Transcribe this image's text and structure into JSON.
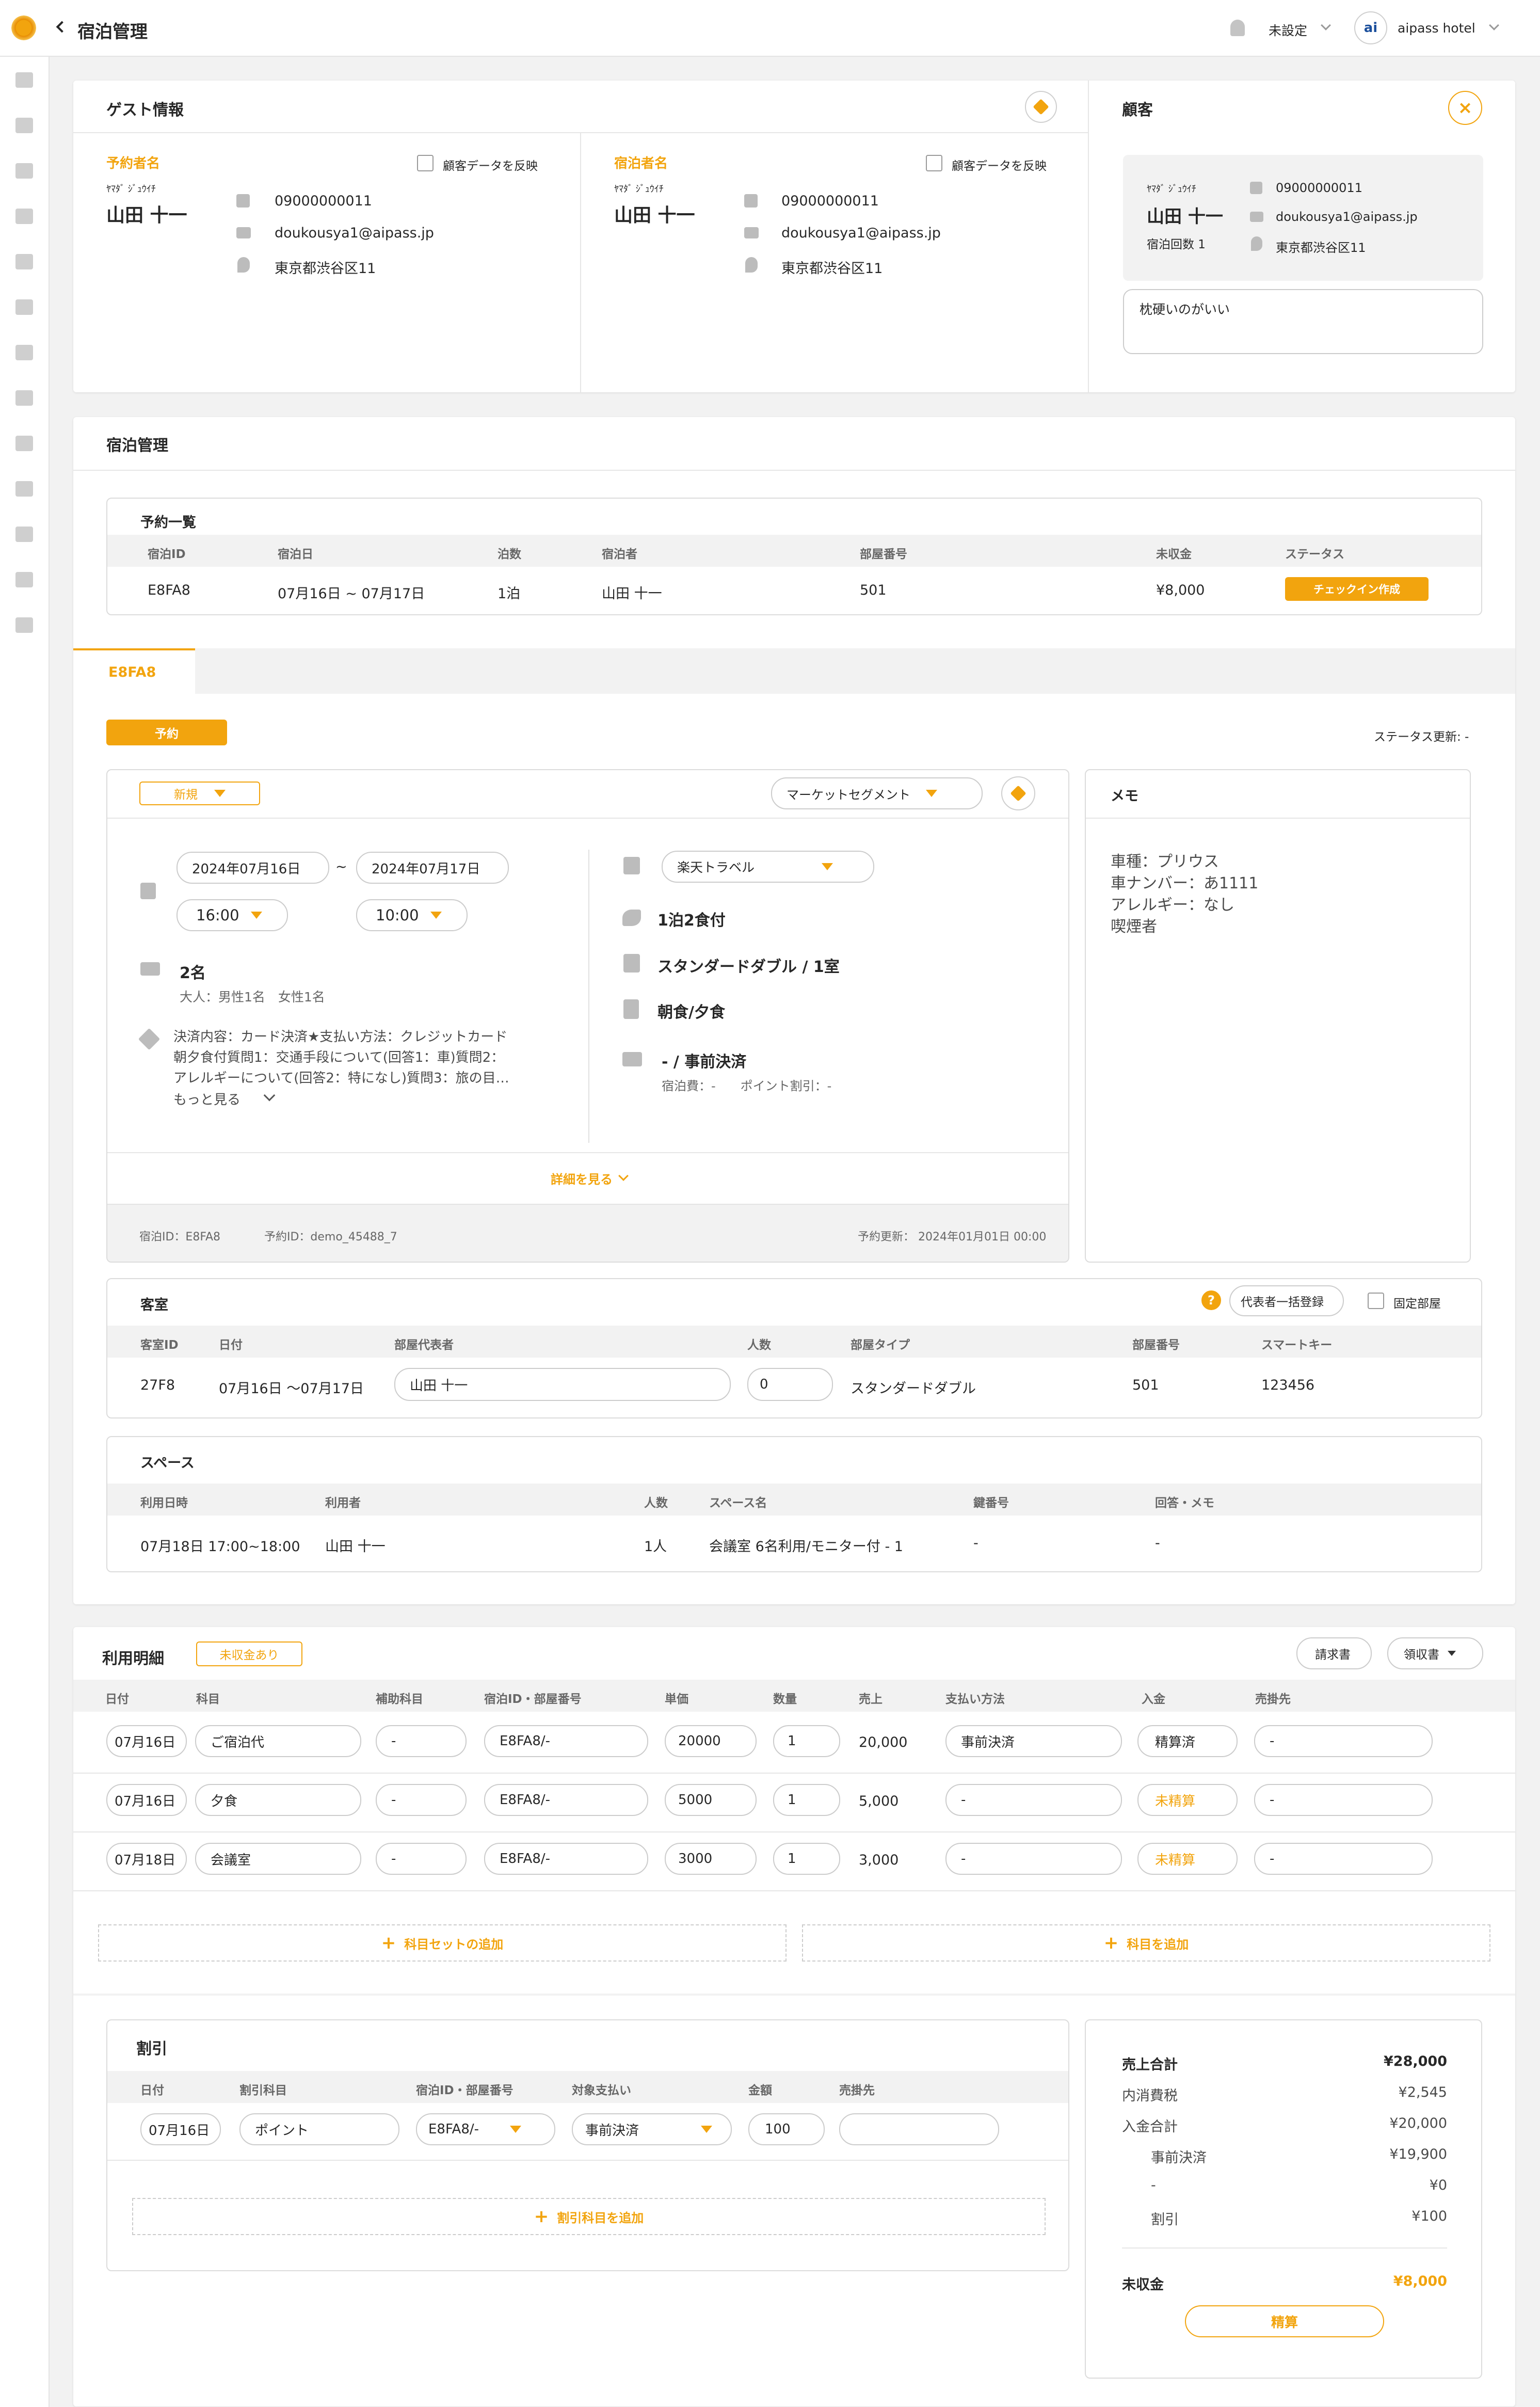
{
  "header": {
    "title": "宿泊管理",
    "notify_status": "未設定",
    "hotel_name": "aipass hotel",
    "logo_text": "ai"
  },
  "sidebar": {
    "icons": [
      "dashboard-icon",
      "bed-icon",
      "id-card-icon",
      "building-icon",
      "calculator-icon",
      "megaphone-icon",
      "service-icon",
      "cleaning-icon",
      "list-icon",
      "mail-icon",
      "chart-icon",
      "news-icon",
      "clock-icon"
    ]
  },
  "guest_info": {
    "title": "ゲスト情報",
    "booker": {
      "label": "予約者名",
      "reflect": "顧客データを反映",
      "kana": "ﾔﾏﾀﾞ ｼﾞｭｳｲﾁ",
      "name": "山田 十一",
      "phone": "09000000011",
      "email": "doukousya1@aipass.jp",
      "address": "東京都渋谷区11"
    },
    "guest": {
      "label": "宿泊者名",
      "reflect": "顧客データを反映",
      "kana": "ﾔﾏﾀﾞ ｼﾞｭｳｲﾁ",
      "name": "山田 十一",
      "phone": "09000000011",
      "email": "doukousya1@aipass.jp",
      "address": "東京都渋谷区11"
    }
  },
  "customer": {
    "title": "顧客",
    "kana": "ﾔﾏﾀﾞ ｼﾞｭｳｲﾁ",
    "name": "山田 十一",
    "stays": "宿泊回数 1",
    "phone": "09000000011",
    "email": "doukousya1@aipass.jp",
    "address": "東京都渋谷区11",
    "note": "枕硬いのがいい"
  },
  "stay": {
    "title": "宿泊管理",
    "reservations": {
      "title": "予約一覧",
      "headers": [
        "宿泊ID",
        "宿泊日",
        "泊数",
        "宿泊者",
        "部屋番号",
        "未収金",
        "ステータス"
      ],
      "row": {
        "id": "E8FA8",
        "date": "07月16日 ~ 07月17日",
        "nights": "1泊",
        "guest": "山田 十一",
        "room": "501",
        "unpaid": "¥8,000",
        "action": "チェックイン作成"
      }
    },
    "tab": "E8FA8",
    "status_badge": "予約",
    "status_updated": "ステータス更新: -",
    "detail": {
      "new_select": "新規",
      "segment_select": "マーケットセグメント",
      "checkin_date": "2024年07月16日",
      "tilde": "~",
      "checkout_date": "2024年07月17日",
      "checkin_time": "16:00",
      "checkout_time": "10:00",
      "people": "2名",
      "people_detail": "大人：男性1名　女性1名",
      "note_lines": [
        "決済内容：カード決済★支払い方法：クレジットカード",
        "朝夕食付質問1：交通手段について(回答1：車)質問2：",
        "アレルギーについて(回答2：特になし)質問3：旅の目…"
      ],
      "more": "もっと見る",
      "channel": "楽天トラベル",
      "plan": "1泊2食付",
      "room_type": "スタンダードダブル / 1室",
      "meal": "朝食/夕食",
      "payment": "- / 事前決済",
      "fees": "宿泊費：-　　ポイント割引：-",
      "detail_link": "詳細を見る",
      "stay_id": "宿泊ID：E8FA8",
      "booking_id": "予約ID：demo_45488_7",
      "updated": "予約更新： 2024年01月01日 00:00"
    },
    "memo": {
      "title": "メモ",
      "lines": [
        "車種：プリウス",
        "車ナンバー：あ1111",
        "アレルギー：なし",
        "喫煙者"
      ]
    },
    "rooms": {
      "title": "客室",
      "bulk": "代表者一括登録",
      "fixed": "固定部屋",
      "help": "?",
      "headers": [
        "客室ID",
        "日付",
        "部屋代表者",
        "人数",
        "部屋タイプ",
        "部屋番号",
        "スマートキー"
      ],
      "row": {
        "id": "27F8",
        "date": "07月16日 〜07月17日",
        "rep": "山田 十一",
        "count": "0",
        "type": "スタンダードダブル",
        "number": "501",
        "key": "123456"
      }
    },
    "space": {
      "title": "スペース",
      "headers": [
        "利用日時",
        "利用者",
        "人数",
        "スペース名",
        "鍵番号",
        "回答・メモ"
      ],
      "row": {
        "datetime": "07月18日 17:00~18:00",
        "user": "山田 十一",
        "count": "1人",
        "name": "会議室 6名利用/モニター付 - 1",
        "key": "-",
        "memo": "-"
      }
    }
  },
  "usage": {
    "title": "利用明細",
    "badge": "未収金あり",
    "invoice": "請求書",
    "receipt": "領収書",
    "headers": [
      "日付",
      "科目",
      "補助科目",
      "宿泊ID・部屋番号",
      "単価",
      "数量",
      "売上",
      "支払い方法",
      "入金",
      "売掛先"
    ],
    "rows": [
      {
        "date": "07月16日",
        "item": "ご宿泊代",
        "sub": "-",
        "id": "E8FA8/-",
        "price": "20000",
        "qty": "1",
        "sales": "20,000",
        "method": "事前決済",
        "paid": "精算済",
        "ar": "-"
      },
      {
        "date": "07月16日",
        "item": "夕食",
        "sub": "-",
        "id": "E8FA8/-",
        "price": "5000",
        "qty": "1",
        "sales": "5,000",
        "method": "-",
        "paid": "未精算",
        "ar": "-"
      },
      {
        "date": "07月18日",
        "item": "会議室",
        "sub": "-",
        "id": "E8FA8/-",
        "price": "3000",
        "qty": "1",
        "sales": "3,000",
        "method": "-",
        "paid": "未精算",
        "ar": "-"
      }
    ],
    "add_set": "科目セットの追加",
    "add_item": "科目を追加"
  },
  "discount": {
    "title": "割引",
    "headers": [
      "日付",
      "割引科目",
      "宿泊ID・部屋番号",
      "対象支払い",
      "金額",
      "売掛先"
    ],
    "row": {
      "date": "07月16日",
      "item": "ポイント",
      "id": "E8FA8/-",
      "target": "事前決済",
      "amount": "100",
      "ar": ""
    },
    "add": "割引科目を追加"
  },
  "summary": {
    "sales_label": "売上合計",
    "sales": "¥28,000",
    "tax_label": "内消費税",
    "tax": "¥2,545",
    "paid_label": "入金合計",
    "paid": "¥20,000",
    "pre_label": "事前決済",
    "pre": "¥19,900",
    "dash_label": "-",
    "dash": "¥0",
    "disc_label": "割引",
    "disc": "¥100",
    "unpaid_label": "未収金",
    "unpaid": "¥8,000",
    "settle": "精算"
  },
  "colors": {
    "accent": "#f2a40e",
    "text": "#272727",
    "muted": "#676767",
    "background": "#f2f2f2"
  }
}
